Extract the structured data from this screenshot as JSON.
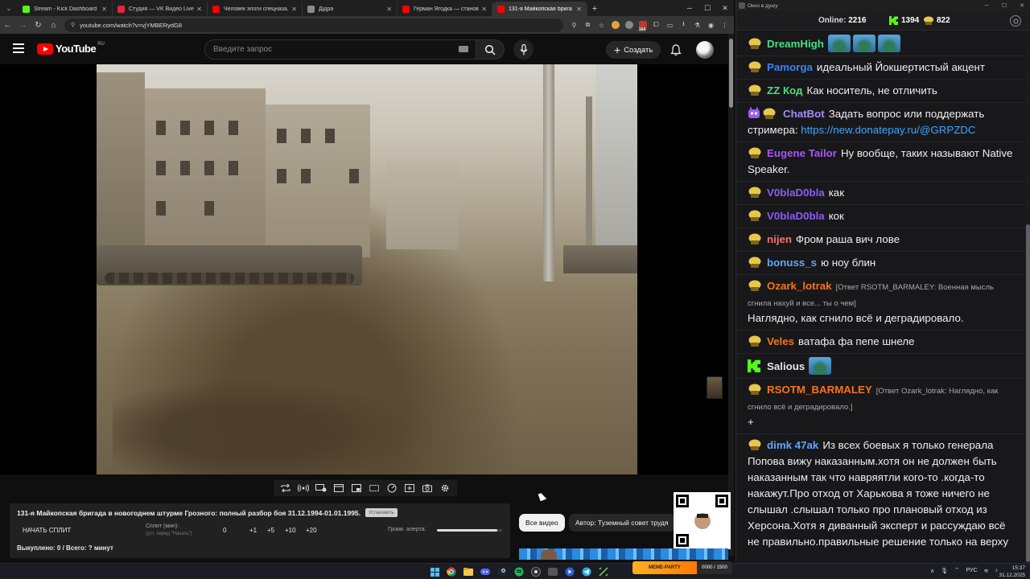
{
  "browser": {
    "tabs": [
      {
        "title": "Stream - Kick Dashboard",
        "color": "#53fc18",
        "active": false
      },
      {
        "title": "Студия — VK Видео Live",
        "color": "#e8243c",
        "active": false
      },
      {
        "title": "Человек элоги спецназа. Как",
        "color": "#ff0000",
        "active": false
      },
      {
        "title": "Дiдра",
        "color": "#8a8a8a",
        "active": false
      },
      {
        "title": "Герман Ягодка — становлен",
        "color": "#ff0000",
        "active": false
      },
      {
        "title": "131-я Майкопская брига",
        "color": "#ff0000",
        "active": true
      }
    ],
    "url": "youtube.com/watch?v=vjYMBERydG8",
    "ext_badge": "164"
  },
  "youtube": {
    "logo_text": "YouTube",
    "region": "RU",
    "search_placeholder": "Введите запрос",
    "create_label": "Создать"
  },
  "split_panel": {
    "title": "131-я Майкопская бригада в новогоднем штурме Грозного: полный разбор боя 31.12.1994-01.01.1995.",
    "badge": "Установить",
    "start_label": "НАЧАТЬ СПЛИТ",
    "split_label": "Сплит (мин):",
    "split_hint": "(уст. перед \"Начать\")",
    "split_value": "0",
    "increments": [
      "+1",
      "+5",
      "+10",
      "+20"
    ],
    "volume_label": "Громк. алерта:",
    "volume_level": 0.93,
    "bought": "Выкуплено: 0 / Всего: ? минут"
  },
  "chips": {
    "all_videos": "Все видео",
    "author": "Автор: Туземный совет трудя"
  },
  "chat": {
    "window_title": "Окно в душу",
    "online_label": "Online:",
    "online_count": "2216",
    "kick_count": "1394",
    "coin_count": "822",
    "messages": [
      {
        "nick": "DreamHigh",
        "color": "#4ade80",
        "text": "",
        "emotes": 3
      },
      {
        "nick": "Pamorga",
        "color": "#3b82f6",
        "text": "идеальный Йокшертистый акцент"
      },
      {
        "nick": "ZZ Код",
        "color": "#4ade80",
        "text": "Как носитель, не отличить"
      },
      {
        "nick": "ChatBot",
        "color": "#a78bfa",
        "text": "Задать вопрос или поддержать стримера: ",
        "link": "https://new.donatepay.ru/@GRPZDC",
        "bot": true
      },
      {
        "nick": "Eugene Tailor",
        "color": "#a855f7",
        "text": "Ну вообще, таких называют Native Speaker."
      },
      {
        "nick": "V0blaD0bla",
        "color": "#8b5cf6",
        "text": "как"
      },
      {
        "nick": "V0blaD0bla",
        "color": "#8b5cf6",
        "text": "кок"
      },
      {
        "nick": "nijen",
        "color": "#f87171",
        "text": "Фром раша вич лове"
      },
      {
        "nick": "bonuss_s",
        "color": "#60a5fa",
        "text": "ю ноу блин"
      },
      {
        "nick": "Ozark_lotrak",
        "color": "#f97316",
        "reply": "[Ответ RSOTM_BARMALEY: Военная мысль сгнила нахуй и все... ты о чем]",
        "text": "Наглядно, как сгнило всё и деградировало."
      },
      {
        "nick": "Veles",
        "color": "#f97316",
        "text": "ватафа фа пепе шнеле"
      },
      {
        "nick": "Salious",
        "color": "#e5e5e5",
        "text": "",
        "emotes": 1,
        "kick": true
      },
      {
        "nick": "RSOTM_BARMALEY",
        "color": "#f97316",
        "reply": "[Ответ Ozark_lotrak: Наглядно, как сгнило всё и деградировало.]",
        "text": "+"
      },
      {
        "nick": "dimk 47ak",
        "color": "#60a5fa",
        "text": "Из всех боевых я только генерала Попова вижу наказанным.хотя он не должен быть наказанным так что навряятли кого-то .когда-то накажут.Про отход от Харькова я тоже ничего не слышал .слышал только про плановый отход из Херсона.Хотя я диванный эксперт и рассуждаю всё не правильно.правильные решение только на верху .они выше им виднее"
      }
    ]
  },
  "widget": {
    "label": "MEME-PARTY",
    "value": "0000 / 1500"
  },
  "taskbar": {
    "lang": "РУС",
    "time": "15:37",
    "date": "31.12.2025"
  }
}
